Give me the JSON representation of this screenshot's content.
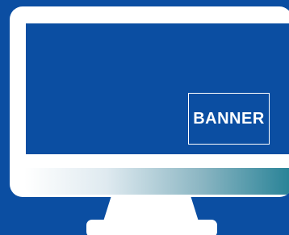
{
  "banner": {
    "label": "BANNER"
  },
  "colors": {
    "background": "#0b4ea2",
    "screen": "#0b4ea2",
    "bezel": "#ffffff",
    "gradient_end": "#1f7e93"
  },
  "icons": {
    "monitor": "monitor-icon"
  }
}
